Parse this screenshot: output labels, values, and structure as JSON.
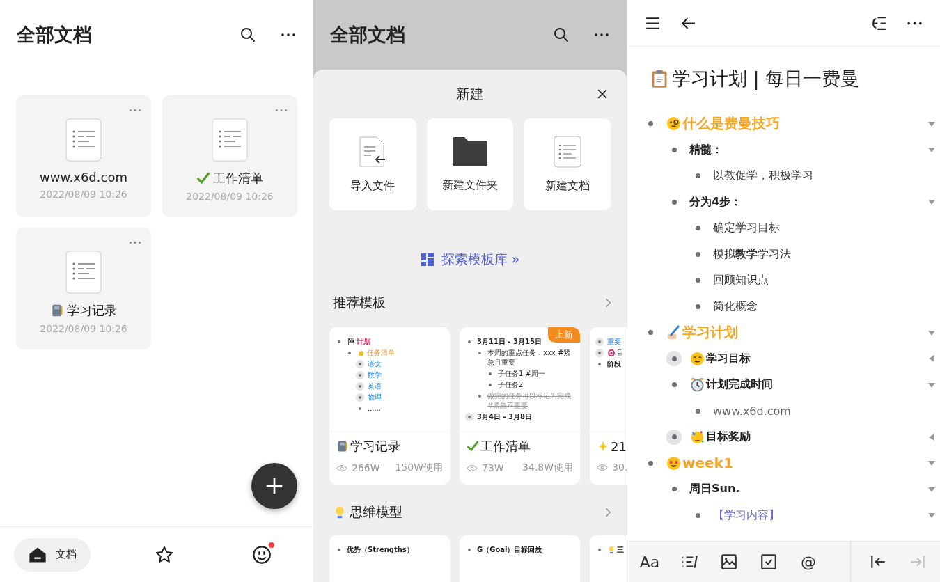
{
  "docs_panel": {
    "title": "全部文档",
    "docs": [
      {
        "title": "www.x6d.com",
        "date": "2022/08/09 10:26"
      },
      {
        "title": "工作清单",
        "date": "2022/08/09 10:26"
      },
      {
        "title": "学习记录",
        "date": "2022/08/09 10:26"
      }
    ],
    "nav": [
      {
        "label": "文档",
        "selected": true,
        "badge": false
      },
      {
        "selected": false,
        "badge": false
      },
      {
        "selected": false,
        "badge": true
      }
    ]
  },
  "new_sheet": {
    "header_title": "全部文档",
    "title": "新建",
    "actions": [
      {
        "label": "导入文件"
      },
      {
        "label": "新建文件夹"
      },
      {
        "label": "新建文档"
      }
    ],
    "explore_link": "探索模板库 »",
    "sections": [
      {
        "title": "推荐模板",
        "cards": [
          {
            "title": "学习记录",
            "views": "266W",
            "uses": "150W使用",
            "preview": [
              {
                "text": "计划",
                "kind": "plan",
                "collapsed": false,
                "children": [
                  {
                    "text": "任务清单",
                    "kind": "task",
                    "collapsed": false,
                    "children": [
                      {
                        "text": "语文",
                        "kind": "subject",
                        "collapsed": true
                      },
                      {
                        "text": "数学",
                        "kind": "subject",
                        "collapsed": true
                      },
                      {
                        "text": "英语",
                        "kind": "subject",
                        "collapsed": true
                      },
                      {
                        "text": "物理",
                        "kind": "subject",
                        "collapsed": true
                      },
                      {
                        "text": "......",
                        "kind": "plain",
                        "collapsed": false
                      }
                    ]
                  }
                ]
              }
            ]
          },
          {
            "title": "工作清单",
            "badge": "上新",
            "views": "73W",
            "uses": "34.8W使用",
            "preview": [
              {
                "text": "3月11日 - 3月15日",
                "kind": "bold",
                "collapsed": false,
                "children": [
                  {
                    "text": "本周的重点任务：xxx #紧急且重要",
                    "kind": "plain",
                    "collapsed": false,
                    "children": [
                      {
                        "text": "子任务1 #周一",
                        "kind": "plain",
                        "collapsed": false
                      },
                      {
                        "text": "子任务2",
                        "kind": "plain",
                        "collapsed": false
                      }
                    ]
                  },
                  {
                    "text": "做完的任务可以标记为完成 #紧急不重要",
                    "kind": "done",
                    "collapsed": false
                  }
                ]
              },
              {
                "text": "3月4日 - 3月8日",
                "kind": "bold",
                "collapsed": true
              }
            ]
          },
          {
            "title": "21",
            "views": "30.",
            "preview": [
              {
                "text": "重要",
                "kind": "subject",
                "collapsed": true
              },
              {
                "text": "目",
                "kind": "plain",
                "collapsed": true
              },
              {
                "text": "阶段",
                "kind": "bold",
                "collapsed": false
              }
            ]
          }
        ]
      },
      {
        "title": "思维模型",
        "cards": [
          {
            "preview": [
              {
                "text": "优势（Strengths）",
                "kind": "bold",
                "collapsed": false
              }
            ]
          },
          {
            "preview": [
              {
                "text": "G（Goal）目标回放",
                "kind": "bold",
                "collapsed": false
              }
            ]
          },
          {
            "preview": [
              {
                "text": "三",
                "kind": "bold",
                "collapsed": false
              }
            ]
          }
        ]
      }
    ]
  },
  "editor": {
    "title": "学习计划 | 每日一费曼",
    "outline": [
      {
        "text": "什么是费曼技巧",
        "kind": "heading",
        "collapsed": false,
        "children": [
          {
            "text": "精髓：",
            "kind": "bold",
            "collapsed": false,
            "children": [
              {
                "text": "以教促学，积极学习",
                "kind": "text",
                "collapsed": false
              }
            ]
          },
          {
            "text": "分为4步：",
            "kind": "bold",
            "collapsed": false,
            "children": [
              {
                "text": "确定学习目标",
                "kind": "text",
                "collapsed": false
              },
              {
                "text": "模拟**教学**学习法",
                "kind": "text",
                "collapsed": false
              },
              {
                "text": "回顾知识点",
                "kind": "text",
                "collapsed": false
              },
              {
                "text": "简化概念",
                "kind": "text",
                "collapsed": false
              }
            ]
          }
        ]
      },
      {
        "text": "学习计划",
        "kind": "heading",
        "collapsed": false,
        "children": [
          {
            "text": "学习目标",
            "kind": "bold",
            "collapsed": true
          },
          {
            "text": "计划完成时间",
            "kind": "bold",
            "collapsed": false,
            "children": [
              {
                "text": "www.x6d.com",
                "kind": "link",
                "collapsed": false
              }
            ]
          },
          {
            "text": "目标奖励",
            "kind": "bold",
            "collapsed": true
          }
        ]
      },
      {
        "text": "week1",
        "kind": "heading",
        "collapsed": false,
        "children": [
          {
            "text": "周日Sun.",
            "kind": "bold",
            "collapsed": false,
            "children": [
              {
                "text": "【学习内容】",
                "kind": "accent",
                "collapsed": false
              }
            ]
          }
        ]
      }
    ],
    "toolbar": [
      {
        "kind": "text",
        "label": "Aa",
        "disabled": false
      },
      {
        "kind": "list",
        "disabled": false
      },
      {
        "kind": "image",
        "disabled": false
      },
      {
        "kind": "checkbox",
        "disabled": false
      },
      {
        "kind": "text",
        "label": "@",
        "disabled": false
      },
      {
        "kind": "outdent",
        "disabled": false
      },
      {
        "kind": "indent",
        "disabled": true
      }
    ]
  }
}
